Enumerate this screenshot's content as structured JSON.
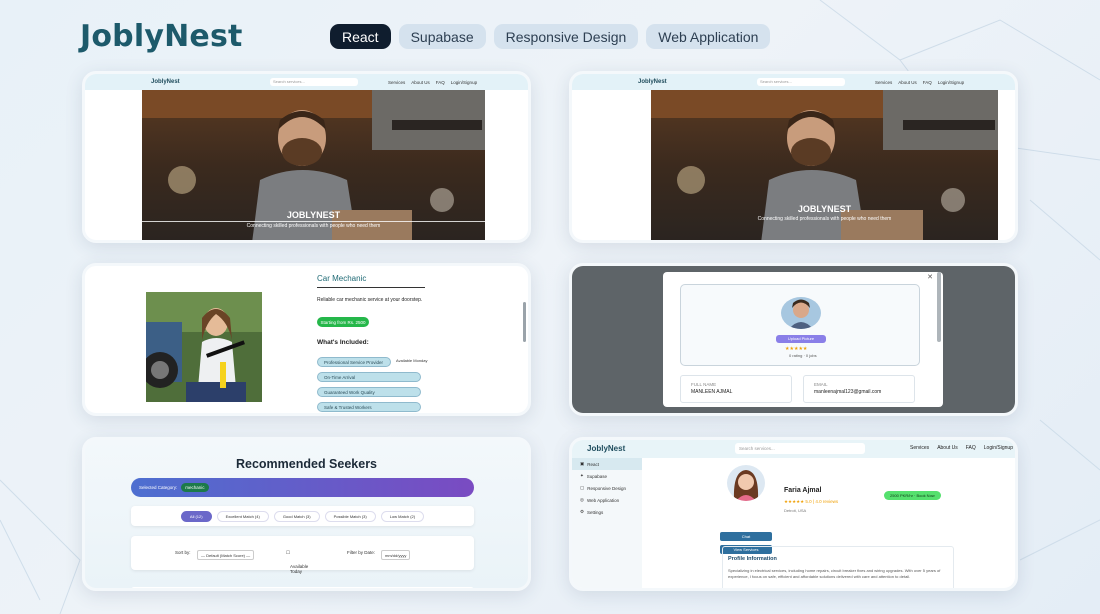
{
  "brand": "JoblyNest",
  "tags": [
    {
      "label": "React",
      "active": true
    },
    {
      "label": "Supabase",
      "active": false
    },
    {
      "label": "Responsive Design",
      "active": false
    },
    {
      "label": "Web Application",
      "active": false
    }
  ],
  "hero": {
    "nav_brand": "JoblyNest",
    "search_placeholder": "Search services...",
    "nav_links": [
      "Services",
      "About Us",
      "FAQ",
      "Login/Signup"
    ],
    "title": "JOBLYNEST",
    "subtitle": "Connecting skilled professionals with people who need them"
  },
  "service": {
    "title": "Car Mechanic",
    "description": "Reliable car mechanic service at your doorstep.",
    "price_badge": "Starting from Rs. 2500",
    "included_label": "What's Included:",
    "items": [
      "Professional Service Provider",
      "On-Time Arrival",
      "Guaranteed Work Quality",
      "Safe & Trusted Workers"
    ],
    "extra": "Available Monday"
  },
  "modal": {
    "button": "Upload Picture",
    "stars": "★★★★★",
    "rating": "0 rating · 0 jobs",
    "fullname_label": "FULL NAME",
    "fullname_value": "MANLEEN AJMAL",
    "email_label": "EMAIL",
    "email_value": "manleenajmal123@gmail.com"
  },
  "seekers": {
    "title": "Recommended Seekers",
    "band_label": "Selected Category:",
    "band_pill": "mechanic",
    "tabs": [
      {
        "label": "All (12)",
        "active": true
      },
      {
        "label": "Excellent Match (4)",
        "active": false
      },
      {
        "label": "Good Match (3)",
        "active": false
      },
      {
        "label": "Possible Match (3)",
        "active": false
      },
      {
        "label": "Low Match (2)",
        "active": false
      }
    ],
    "sort_label": "Sort by:",
    "sort_value": "— Default (Match Score) —",
    "available_label": "Available Today",
    "date_label": "Filter by Date:",
    "date_value": "mm/dd/yyyy"
  },
  "dashboard": {
    "brand": "JoblyNest",
    "search_placeholder": "Search services...",
    "nav_links": [
      "Services",
      "About Us",
      "FAQ",
      "Login/Signup"
    ],
    "sidebar": [
      "React",
      "Supabase",
      "Responsive Design",
      "Web Application",
      "Settings"
    ],
    "profile_name": "Faria Ajmal",
    "stars": "★★★★★ 5.0 | 4.0 reviews",
    "location": "Detroit, USA",
    "badge": "2500 PKR/hr · Book Now",
    "btn1": "Chat",
    "btn2": "View Services",
    "info_title": "Profile Information",
    "info_text": "Specializing in electrical services, including home repairs, circuit breaker fixes and wiring upgrades. With over 5 years of experience, I focus on safe, efficient and affordable solutions delivered with care and attention to detail."
  }
}
